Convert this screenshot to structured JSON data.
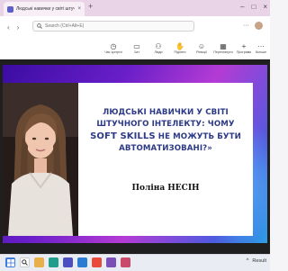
{
  "browser": {
    "tab_title": "Людські навички у світі штучн...",
    "tab_close": "×",
    "new_tab": "+",
    "window_controls": [
      "–",
      "□",
      "×"
    ]
  },
  "header": {
    "nav_back": "‹",
    "nav_forward": "›",
    "search_placeholder": "Search (Ctrl+Alt+E)",
    "more": "···"
  },
  "toolbar": {
    "items": [
      {
        "label": "Час зустрічі",
        "icon": "clock-icon",
        "glyph": "◷"
      },
      {
        "label": "Чат",
        "icon": "chat-icon",
        "glyph": "▭"
      },
      {
        "label": "Люди",
        "icon": "people-icon",
        "glyph": "⚇"
      },
      {
        "label": "Підняти",
        "icon": "raise-hand-icon",
        "glyph": "✋"
      },
      {
        "label": "Реакції",
        "icon": "reaction-icon",
        "glyph": "☺"
      },
      {
        "label": "Переглянути",
        "icon": "view-icon",
        "glyph": "▦"
      },
      {
        "label": "Програми",
        "icon": "apps-icon",
        "glyph": "+"
      },
      {
        "label": "Більше",
        "icon": "more-icon",
        "glyph": "···"
      }
    ],
    "leave_glyph": "✆"
  },
  "slide": {
    "title_line1": "ЛЮДСЬКІ НАВИЧКИ У СВІТІ",
    "title_line2": "ШТУЧНОГО ІНТЕЛЕКТУ: ЧОМУ",
    "title_big": "SOFT SKILLS",
    "title_line3_rest": " НЕ МОЖУТЬ БУТИ",
    "title_line4": "АВТОМАТИЗОВАНІ?»",
    "author": "Поліна НЕСІН"
  },
  "taskbar": {
    "tray_text": "Result",
    "tray_arrow": "^"
  },
  "colors": {
    "accent": "#5b5fc7",
    "slide_title": "#2c3a87",
    "leave": "#c4314b"
  }
}
